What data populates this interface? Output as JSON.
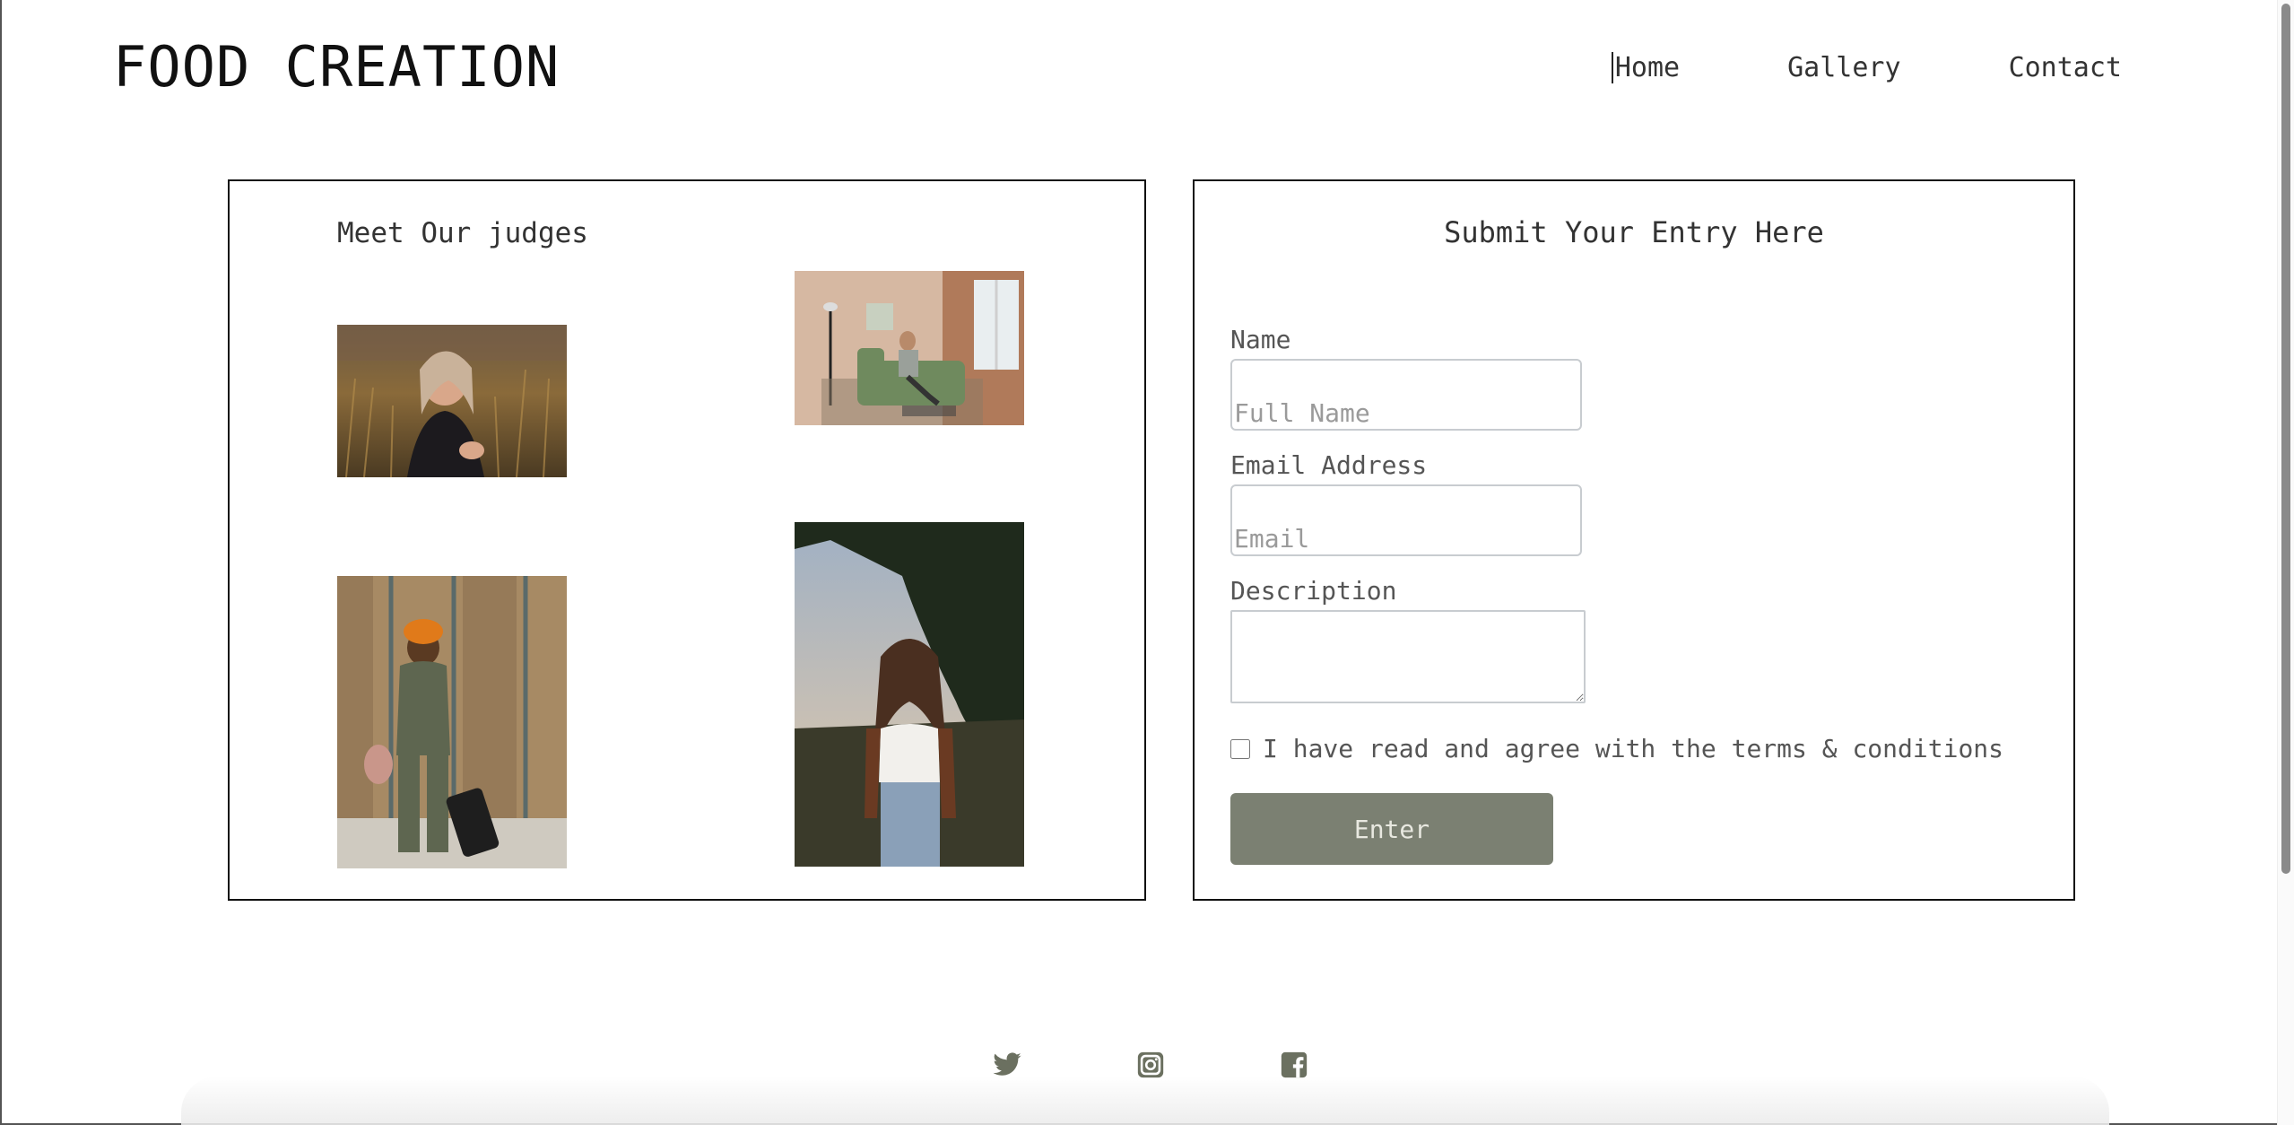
{
  "header": {
    "logo": "FOOD CREATION",
    "nav": [
      {
        "label": "Home",
        "active": true
      },
      {
        "label": "Gallery"
      },
      {
        "label": "Contact"
      }
    ]
  },
  "judges": {
    "title": "Meet Our judges",
    "photos": [
      {
        "subject": "woman sitting in tall grass at sunset"
      },
      {
        "subject": "man relaxing on green sofa in living room"
      },
      {
        "subject": "woman with orange headwrap pulling suitcase"
      },
      {
        "subject": "woman with long hair standing by trees at dusk"
      }
    ]
  },
  "entry_form": {
    "title": "Submit Your Entry Here",
    "name_label": "Name",
    "name_placeholder": "Full Name",
    "email_label": "Email Address",
    "email_placeholder": "Email",
    "description_label": "Description",
    "terms_label": "I have read and agree with the terms & conditions",
    "submit_label": "Enter",
    "submit_color": "#7b8072"
  },
  "footer": {
    "socials": [
      {
        "icon": "twitter-icon"
      },
      {
        "icon": "instagram-icon"
      },
      {
        "icon": "facebook-icon"
      }
    ],
    "icon_color": "#6b7060"
  }
}
